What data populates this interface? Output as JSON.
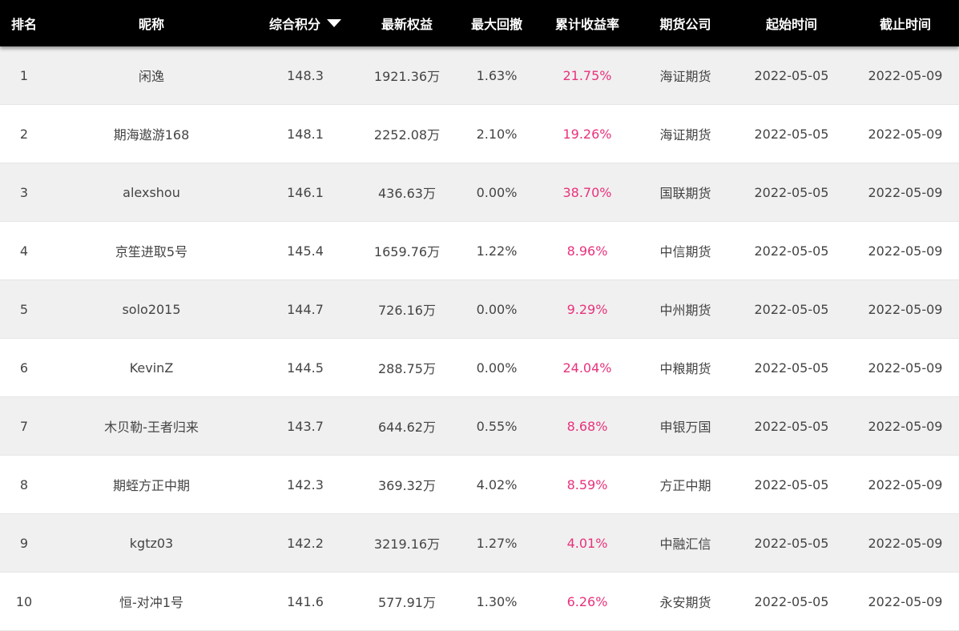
{
  "header": {
    "rank": "排名",
    "nickname": "昵称",
    "score": "综合积分",
    "equity": "最新权益",
    "drawdown": "最大回撤",
    "return": "累计收益率",
    "company": "期货公司",
    "start": "起始时间",
    "end": "截止时间"
  },
  "icons": {
    "sort": "sort-desc-icon"
  },
  "colors": {
    "header_bg": "#000000",
    "accent_return": "#e8327c",
    "row_alt": "#f0f0f0"
  },
  "rows": [
    {
      "rank": "1",
      "nickname": "闲逸",
      "score": "148.3",
      "equity": "1921.36万",
      "drawdown": "1.63%",
      "return": "21.75%",
      "company": "海证期货",
      "start": "2022-05-05",
      "end": "2022-05-09"
    },
    {
      "rank": "2",
      "nickname": "期海遨游168",
      "score": "148.1",
      "equity": "2252.08万",
      "drawdown": "2.10%",
      "return": "19.26%",
      "company": "海证期货",
      "start": "2022-05-05",
      "end": "2022-05-09"
    },
    {
      "rank": "3",
      "nickname": "alexshou",
      "score": "146.1",
      "equity": "436.63万",
      "drawdown": "0.00%",
      "return": "38.70%",
      "company": "国联期货",
      "start": "2022-05-05",
      "end": "2022-05-09"
    },
    {
      "rank": "4",
      "nickname": "京笙进取5号",
      "score": "145.4",
      "equity": "1659.76万",
      "drawdown": "1.22%",
      "return": "8.96%",
      "company": "中信期货",
      "start": "2022-05-05",
      "end": "2022-05-09"
    },
    {
      "rank": "5",
      "nickname": "solo2015",
      "score": "144.7",
      "equity": "726.16万",
      "drawdown": "0.00%",
      "return": "9.29%",
      "company": "中州期货",
      "start": "2022-05-05",
      "end": "2022-05-09"
    },
    {
      "rank": "6",
      "nickname": "KevinZ",
      "score": "144.5",
      "equity": "288.75万",
      "drawdown": "0.00%",
      "return": "24.04%",
      "company": "中粮期货",
      "start": "2022-05-05",
      "end": "2022-05-09"
    },
    {
      "rank": "7",
      "nickname": "木贝勒-王者归来",
      "score": "143.7",
      "equity": "644.62万",
      "drawdown": "0.55%",
      "return": "8.68%",
      "company": "申银万国",
      "start": "2022-05-05",
      "end": "2022-05-09"
    },
    {
      "rank": "8",
      "nickname": "期蛭方正中期",
      "score": "142.3",
      "equity": "369.32万",
      "drawdown": "4.02%",
      "return": "8.59%",
      "company": "方正中期",
      "start": "2022-05-05",
      "end": "2022-05-09"
    },
    {
      "rank": "9",
      "nickname": "kgtz03",
      "score": "142.2",
      "equity": "3219.16万",
      "drawdown": "1.27%",
      "return": "4.01%",
      "company": "中融汇信",
      "start": "2022-05-05",
      "end": "2022-05-09"
    },
    {
      "rank": "10",
      "nickname": "恒-对冲1号",
      "score": "141.6",
      "equity": "577.91万",
      "drawdown": "1.30%",
      "return": "6.26%",
      "company": "永安期货",
      "start": "2022-05-05",
      "end": "2022-05-09"
    }
  ]
}
